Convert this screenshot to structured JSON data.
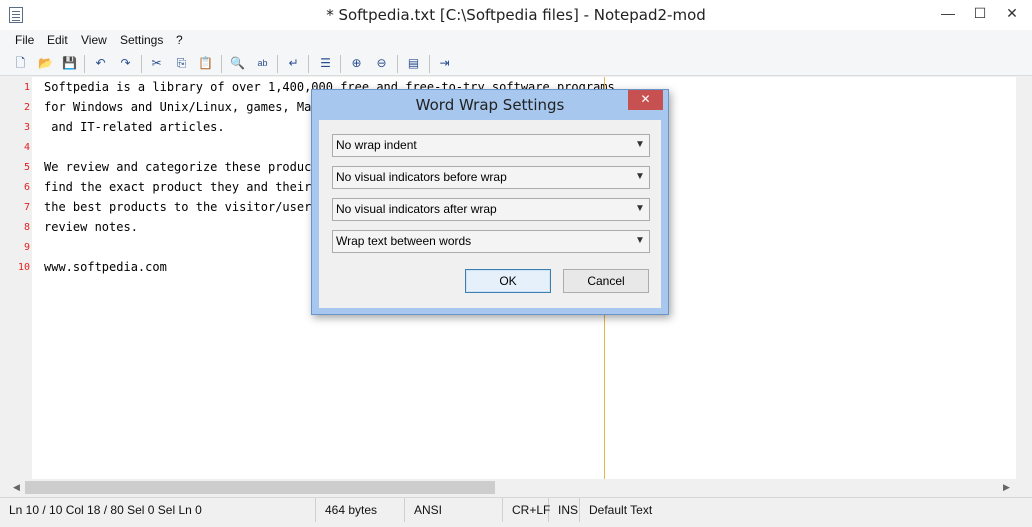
{
  "window": {
    "title": "* Softpedia.txt [C:\\Softpedia files] - Notepad2-mod",
    "minimize": "—",
    "maximize": "☐",
    "close": "✕"
  },
  "menu": [
    "File",
    "Edit",
    "View",
    "Settings",
    "?"
  ],
  "toolbar": {
    "icons": [
      "new-file-icon",
      "open-icon",
      "save-icon",
      "undo-icon",
      "redo-icon",
      "cut-icon",
      "copy-icon",
      "paste-icon",
      "find-icon",
      "replace-icon",
      "word-wrap-icon",
      "whitespace-icon",
      "zoom-in-icon",
      "zoom-out-icon",
      "scheme-icon",
      "exit-icon"
    ],
    "glyphs": [
      "🗋",
      "📂",
      "💾",
      "↶",
      "↷",
      "✂",
      "⎘",
      "📋",
      "🔍",
      "ab",
      "↵",
      "☰",
      "⊕",
      "⊖",
      "▤",
      "⇥"
    ]
  },
  "editor": {
    "line_numbers": [
      "1",
      "2",
      "3",
      "4",
      "5",
      "6",
      "7",
      "8",
      "9",
      "10"
    ],
    "lines": [
      "Softpedia is a library of over 1,400,000 free and free-to-try software programs",
      "for Windows and Unix/Linux, games, Mac",
      " and IT-related articles.",
      "",
      "We review and categorize these product",
      "find the exact product they and their",
      "the best products to the visitor/user",
      "review notes.",
      "",
      "www.softpedia.com"
    ]
  },
  "statusbar": {
    "position": "Ln 10 / 10   Col 18 / 80   Sel 0   Sel Ln 0",
    "size": "464 bytes",
    "encoding": "ANSI",
    "eol": "CR+LF",
    "mode": "INS",
    "scheme": "Default Text"
  },
  "dialog": {
    "title": "Word Wrap Settings",
    "close": "✕",
    "options": [
      "No wrap indent",
      "No visual indicators before wrap",
      "No visual indicators after wrap",
      "Wrap text between words"
    ],
    "ok_label": "OK",
    "cancel_label": "Cancel"
  },
  "colors": {
    "line_number": "#e02020",
    "edge_line": "#e8b54a",
    "dialog_frame": "#a7c7ef",
    "close_button": "#c75050"
  }
}
